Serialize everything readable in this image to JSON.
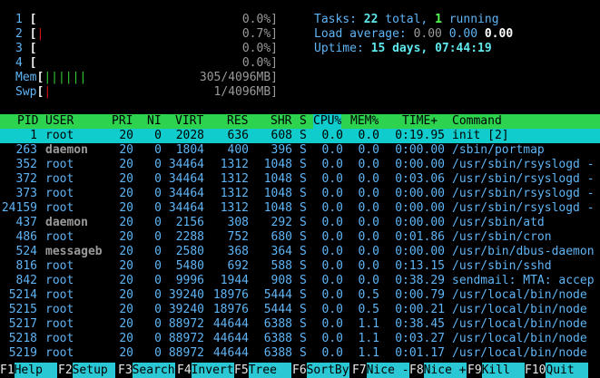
{
  "cpus": [
    {
      "num": "1",
      "bar": "",
      "pct": "0.0%]"
    },
    {
      "num": "2",
      "bar": "|",
      "pct": "0.7%]"
    },
    {
      "num": "3",
      "bar": "",
      "pct": "0.0%]"
    },
    {
      "num": "4",
      "bar": "",
      "pct": "0.0%]"
    }
  ],
  "mem": {
    "label": "Mem",
    "bar": "||||||",
    "value": "305/4096MB]"
  },
  "swp": {
    "label": "Swp",
    "bar": "|",
    "value": "1/4096MB]"
  },
  "open_bracket": "[",
  "stats": {
    "tasks_label": "Tasks: ",
    "tasks_total": "22",
    "tasks_mid": " total, ",
    "tasks_running": "1",
    "tasks_end": " running",
    "load_label": "Load average: ",
    "load1": "0.00",
    "load5": "0.00",
    "load15": "0.00",
    "uptime_label": "Uptime: ",
    "uptime_value": "15 days, 07:44:19"
  },
  "columns": [
    "PID",
    "USER",
    "PRI",
    "NI",
    "VIRT",
    "RES",
    "SHR",
    "S",
    "CPU%",
    "MEM%",
    "TIME+",
    "Command"
  ],
  "processes": [
    {
      "pid": "1",
      "user": "root",
      "pri": "20",
      "ni": "0",
      "virt": "2028",
      "res": "636",
      "shr": "608",
      "s": "S",
      "cpu": "0.0",
      "mem": "0.0",
      "time": "0:19.95",
      "cmd": "init [2]",
      "selected": true
    },
    {
      "pid": "263",
      "user": "daemon",
      "pri": "20",
      "ni": "0",
      "virt": "1804",
      "res": "400",
      "shr": "396",
      "s": "S",
      "cpu": "0.0",
      "mem": "0.0",
      "time": "0:00.00",
      "cmd": "/sbin/portmap"
    },
    {
      "pid": "352",
      "user": "root",
      "pri": "20",
      "ni": "0",
      "virt": "34464",
      "res": "1312",
      "shr": "1048",
      "s": "S",
      "cpu": "0.0",
      "mem": "0.0",
      "time": "0:00.00",
      "cmd": "/usr/sbin/rsyslogd -"
    },
    {
      "pid": "372",
      "user": "root",
      "pri": "20",
      "ni": "0",
      "virt": "34464",
      "res": "1312",
      "shr": "1048",
      "s": "S",
      "cpu": "0.0",
      "mem": "0.0",
      "time": "0:03.06",
      "cmd": "/usr/sbin/rsyslogd -"
    },
    {
      "pid": "373",
      "user": "root",
      "pri": "20",
      "ni": "0",
      "virt": "34464",
      "res": "1312",
      "shr": "1048",
      "s": "S",
      "cpu": "0.0",
      "mem": "0.0",
      "time": "0:00.00",
      "cmd": "/usr/sbin/rsyslogd -"
    },
    {
      "pid": "24159",
      "user": "root",
      "pri": "20",
      "ni": "0",
      "virt": "34464",
      "res": "1312",
      "shr": "1048",
      "s": "S",
      "cpu": "0.0",
      "mem": "0.0",
      "time": "0:00.00",
      "cmd": "/usr/sbin/rsyslogd -"
    },
    {
      "pid": "437",
      "user": "daemon",
      "pri": "20",
      "ni": "0",
      "virt": "2156",
      "res": "308",
      "shr": "292",
      "s": "S",
      "cpu": "0.0",
      "mem": "0.0",
      "time": "0:00.00",
      "cmd": "/usr/sbin/atd"
    },
    {
      "pid": "486",
      "user": "root",
      "pri": "20",
      "ni": "0",
      "virt": "2288",
      "res": "752",
      "shr": "680",
      "s": "S",
      "cpu": "0.0",
      "mem": "0.0",
      "time": "0:01.86",
      "cmd": "/usr/sbin/cron"
    },
    {
      "pid": "524",
      "user": "messageb",
      "pri": "20",
      "ni": "0",
      "virt": "2580",
      "res": "368",
      "shr": "364",
      "s": "S",
      "cpu": "0.0",
      "mem": "0.0",
      "time": "0:00.00",
      "cmd": "/usr/bin/dbus-daemon"
    },
    {
      "pid": "816",
      "user": "root",
      "pri": "20",
      "ni": "0",
      "virt": "5480",
      "res": "692",
      "shr": "588",
      "s": "S",
      "cpu": "0.0",
      "mem": "0.0",
      "time": "0:13.15",
      "cmd": "/usr/sbin/sshd"
    },
    {
      "pid": "842",
      "user": "root",
      "pri": "20",
      "ni": "0",
      "virt": "9996",
      "res": "1944",
      "shr": "908",
      "s": "S",
      "cpu": "0.0",
      "mem": "0.0",
      "time": "0:38.29",
      "cmd": "sendmail: MTA: accep"
    },
    {
      "pid": "5214",
      "user": "root",
      "pri": "20",
      "ni": "0",
      "virt": "39240",
      "res": "18976",
      "shr": "5444",
      "s": "S",
      "cpu": "0.0",
      "mem": "0.5",
      "time": "0:00.79",
      "cmd": "/usr/local/bin/node"
    },
    {
      "pid": "5215",
      "user": "root",
      "pri": "20",
      "ni": "0",
      "virt": "39240",
      "res": "18976",
      "shr": "5444",
      "s": "S",
      "cpu": "0.0",
      "mem": "0.5",
      "time": "0:00.21",
      "cmd": "/usr/local/bin/node"
    },
    {
      "pid": "5217",
      "user": "root",
      "pri": "20",
      "ni": "0",
      "virt": "88972",
      "res": "44644",
      "shr": "6388",
      "s": "S",
      "cpu": "0.0",
      "mem": "1.1",
      "time": "0:38.45",
      "cmd": "/usr/local/bin/node"
    },
    {
      "pid": "5218",
      "user": "root",
      "pri": "20",
      "ni": "0",
      "virt": "88972",
      "res": "44644",
      "shr": "6388",
      "s": "S",
      "cpu": "0.0",
      "mem": "1.1",
      "time": "0:03.27",
      "cmd": "/usr/local/bin/node"
    },
    {
      "pid": "5219",
      "user": "root",
      "pri": "20",
      "ni": "0",
      "virt": "88972",
      "res": "44644",
      "shr": "6388",
      "s": "S",
      "cpu": "0.0",
      "mem": "1.1",
      "time": "0:01.17",
      "cmd": "/usr/local/bin/node"
    }
  ],
  "footer": [
    {
      "key": "F1",
      "label": "Help  "
    },
    {
      "key": "F2",
      "label": "Setup "
    },
    {
      "key": "F3",
      "label": "Search"
    },
    {
      "key": "F4",
      "label": "Invert"
    },
    {
      "key": "F5",
      "label": "Tree  "
    },
    {
      "key": "F6",
      "label": "SortBy"
    },
    {
      "key": "F7",
      "label": "Nice -"
    },
    {
      "key": "F8",
      "label": "Nice +"
    },
    {
      "key": "F9",
      "label": "Kill  "
    },
    {
      "key": "F10",
      "label": "Quit  "
    }
  ]
}
